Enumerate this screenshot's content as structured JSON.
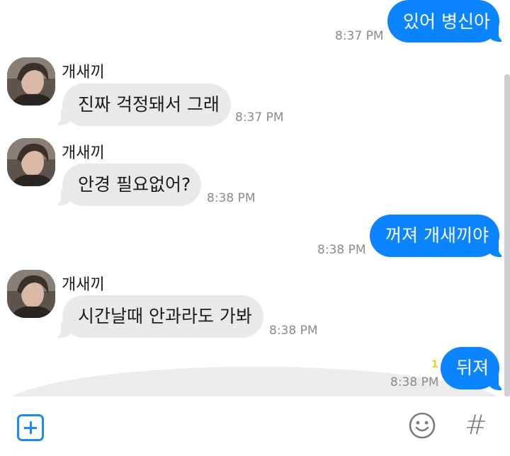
{
  "messages": [
    {
      "dir": "out",
      "text": "있어 병신아",
      "time": "8:37 PM"
    },
    {
      "dir": "in",
      "sender": "개새끼",
      "text": "진짜 걱정돼서 그래",
      "time": "8:37 PM"
    },
    {
      "dir": "in",
      "sender": "개새끼",
      "text": "안경 필요없어?",
      "time": "8:38 PM"
    },
    {
      "dir": "out",
      "text": "꺼져 개새끼야",
      "time": "8:38 PM"
    },
    {
      "dir": "in",
      "sender": "개새끼",
      "text": "시간날때 안과라도 가봐",
      "time": "8:38 PM"
    },
    {
      "dir": "out",
      "text": "뒤져",
      "time": "8:38 PM",
      "unread": "1"
    }
  ],
  "colors": {
    "outgoing_bubble": "#0a84ff",
    "incoming_bubble": "#e9e9eb",
    "accent": "#1c8cf0",
    "unread_mark": "#e8d21c"
  },
  "icons": {
    "add": "plus-square-icon",
    "emoji": "smiley-icon",
    "hashtag": "hash-icon"
  },
  "bottom_bar": {
    "hash_glyph": "#"
  }
}
